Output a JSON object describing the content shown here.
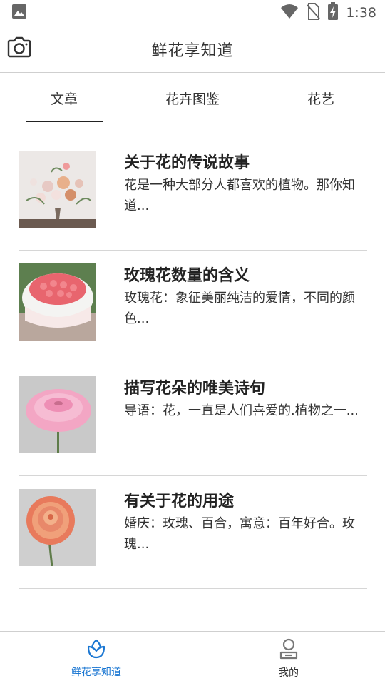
{
  "status_bar": {
    "time": "1:38"
  },
  "app_bar": {
    "title": "鲜花享知道"
  },
  "tabs": [
    {
      "label": "文章"
    },
    {
      "label": "花卉图鉴"
    },
    {
      "label": "花艺"
    }
  ],
  "articles": [
    {
      "title": "关于花的传说故事",
      "desc": "花是一种大部分人都喜欢的植物。那你知道..."
    },
    {
      "title": "玫瑰花数量的含义",
      "desc": "玫瑰花：象征美丽纯洁的爱情，不同的颜色..."
    },
    {
      "title": "描写花朵的唯美诗句",
      "desc": "导语：花，一直是人们喜爱的.植物之一..."
    },
    {
      "title": "有关于花的用途",
      "desc": "婚庆：玫瑰、百合，寓意：百年好合。玫瑰..."
    }
  ],
  "bottom_nav": [
    {
      "label": "鲜花享知道",
      "icon": "flower-icon"
    },
    {
      "label": "我的",
      "icon": "profile-icon"
    }
  ],
  "colors": {
    "accent": "#1976d2",
    "divider": "#d6d6d6"
  }
}
